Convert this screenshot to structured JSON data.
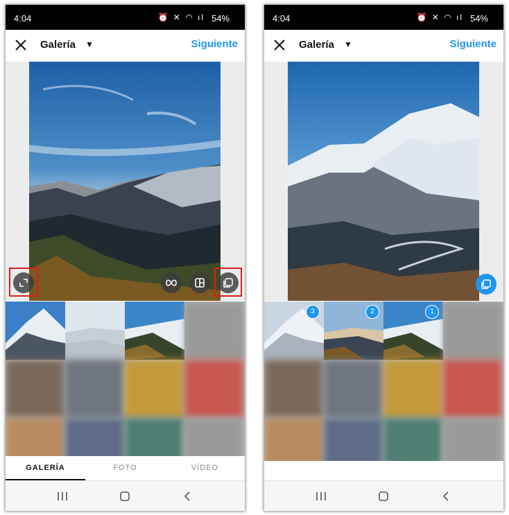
{
  "left": {
    "status": {
      "time": "4:04",
      "battery": "54%"
    },
    "header": {
      "title": "Galería",
      "next_label": "Siguiente"
    },
    "tabs": [
      {
        "label": "GALERÍA",
        "active": true
      },
      {
        "label": "FOTO",
        "active": false
      },
      {
        "label": "VÍDEO",
        "active": false
      }
    ]
  },
  "right": {
    "status": {
      "time": "4:04",
      "battery": "54%"
    },
    "header": {
      "title": "Galería",
      "next_label": "Siguiente"
    },
    "selection_badges": [
      "3",
      "2",
      "1"
    ]
  },
  "colors": {
    "accent": "#1f96f0",
    "highlight": "#e01b1b"
  },
  "icons": [
    "close-icon",
    "dropdown-caret-icon",
    "expand-icon",
    "boomerang-icon",
    "layout-icon",
    "multi-select-icon",
    "recents-icon",
    "home-icon",
    "back-icon"
  ]
}
